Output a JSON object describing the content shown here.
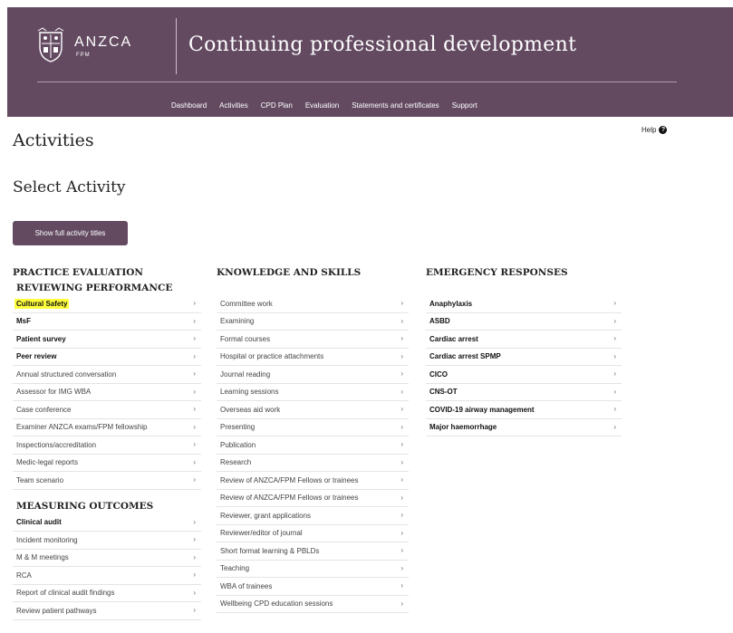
{
  "header": {
    "logo_text": "ANZCA",
    "logo_sub": "FPM",
    "site_title": "Continuing professional development",
    "nav": [
      "Dashboard",
      "Activities",
      "CPD Plan",
      "Evaluation",
      "Statements and certificates",
      "Support"
    ]
  },
  "page": {
    "title": "Activities",
    "help_label": "Help",
    "section_title": "Select Activity",
    "show_button": "Show full activity titles"
  },
  "practice": {
    "title": "PRACTICE EVALUATION",
    "reviewing_title": "REVIEWING PERFORMANCE",
    "reviewing": [
      {
        "label": "Cultural Safety",
        "bold": true,
        "highlight": true
      },
      {
        "label": "MsF",
        "bold": true
      },
      {
        "label": "Patient survey",
        "bold": true
      },
      {
        "label": "Peer review",
        "bold": true
      },
      {
        "label": "Annual structured conversation"
      },
      {
        "label": "Assessor for IMG WBA"
      },
      {
        "label": "Case conference"
      },
      {
        "label": "Examiner ANZCA exams/FPM fellowship"
      },
      {
        "label": "Inspections/accreditation"
      },
      {
        "label": "Medic-legal reports"
      },
      {
        "label": "Team scenario"
      }
    ],
    "measuring_title": "MEASURING OUTCOMES",
    "measuring": [
      {
        "label": "Clinical audit",
        "bold": true
      },
      {
        "label": "Incident monitoring"
      },
      {
        "label": "M & M meetings"
      },
      {
        "label": "RCA"
      },
      {
        "label": "Report of clinical audit findings"
      },
      {
        "label": "Review patient pathways"
      }
    ]
  },
  "knowledge": {
    "title": "KNOWLEDGE AND SKILLS",
    "items": [
      {
        "label": "Committee work"
      },
      {
        "label": "Examining"
      },
      {
        "label": "Formal courses"
      },
      {
        "label": "Hospital or practice attachments"
      },
      {
        "label": "Journal reading"
      },
      {
        "label": "Learning sessions"
      },
      {
        "label": "Overseas aid work"
      },
      {
        "label": "Presenting"
      },
      {
        "label": "Publication"
      },
      {
        "label": "Research"
      },
      {
        "label": "Review of ANZCA/FPM Fellows or trainees"
      },
      {
        "label": "Review of ANZCA/FPM Fellows or trainees"
      },
      {
        "label": "Reviewer, grant applications"
      },
      {
        "label": "Reviewer/editor of journal"
      },
      {
        "label": "Short format learning & PBLDs"
      },
      {
        "label": "Teaching"
      },
      {
        "label": "WBA of trainees"
      },
      {
        "label": "Wellbeing CPD education sessions"
      }
    ]
  },
  "emergency": {
    "title": "EMERGENCY RESPONSES",
    "items": [
      {
        "label": "Anaphylaxis",
        "bold": true
      },
      {
        "label": "ASBD",
        "bold": true
      },
      {
        "label": "Cardiac arrest",
        "bold": true
      },
      {
        "label": "Cardiac arrest SPMP",
        "bold": true
      },
      {
        "label": "CICO",
        "bold": true
      },
      {
        "label": "CNS-OT",
        "bold": true
      },
      {
        "label": "COVID-19 airway management",
        "bold": true
      },
      {
        "label": "Major haemorrhage",
        "bold": true
      }
    ]
  },
  "chevron": "›",
  "colors": {
    "brand": "#634a61",
    "highlight": "#ffff3d"
  }
}
